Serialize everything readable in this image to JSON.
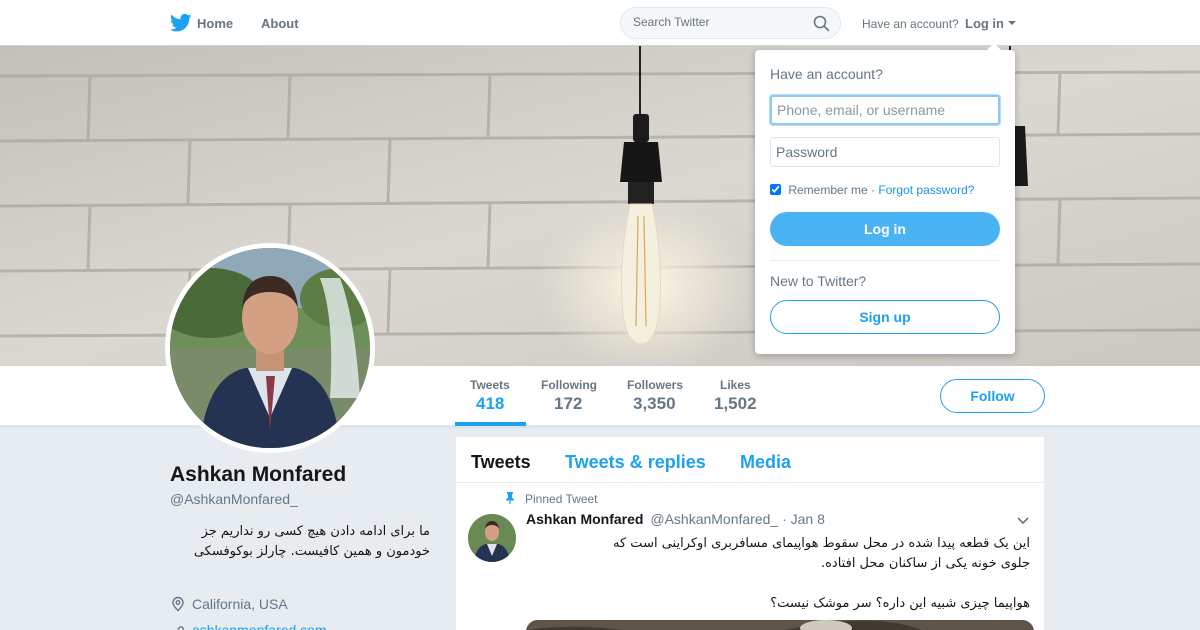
{
  "nav": {
    "home_label": "Home",
    "about_label": "About",
    "search_placeholder": "Search Twitter",
    "have_account_text": "Have an account?",
    "login_label": "Log in"
  },
  "profile": {
    "name": "Ashkan Monfared",
    "handle": "@AshkanMonfared_",
    "bio": "ما برای ادامه دادن هیچ کسی رو نداریم جز خودمون و همین کافیست. چارلز بوکوفسکی",
    "location": "California, USA",
    "link": "ashkanmonfared.com",
    "follow_label": "Follow"
  },
  "stats": [
    {
      "label": "Tweets",
      "value": "418"
    },
    {
      "label": "Following",
      "value": "172"
    },
    {
      "label": "Followers",
      "value": "3,350"
    },
    {
      "label": "Likes",
      "value": "1,502"
    }
  ],
  "timeline": {
    "tabs": [
      "Tweets",
      "Tweets & replies",
      "Media"
    ],
    "pinned_label": "Pinned Tweet",
    "tweet": {
      "name": "Ashkan Monfared",
      "handle": "@AshkanMonfared_",
      "date": "· Jan 8",
      "line1": "این یک قطعه پیدا شده در محل سقوط هواپیمای مسافربری اوکراینی است که",
      "line2": "جلوی خونه یکی از ساکنان محل افتاده.",
      "line3": "هواپیما چیزی شبیه این داره؟ سر موشک نیست؟"
    }
  },
  "login_dropdown": {
    "title": "Have an account?",
    "username_placeholder": "Phone, email, or username",
    "password_placeholder": "Password",
    "remember_label": "Remember me",
    "separator": "·",
    "forgot_label": "Forgot password?",
    "login_button": "Log in",
    "new_text": "New to Twitter?",
    "signup_button": "Sign up"
  },
  "colors": {
    "accent": "#1da1f2",
    "login_button": "#4ab3f4",
    "background": "#e6ecf0"
  },
  "icons": {
    "brand": "twitter-bird-icon",
    "search": "search-icon",
    "location": "location-pin-icon",
    "link": "link-icon",
    "pin": "pin-icon",
    "menu": "chevron-down-icon"
  }
}
